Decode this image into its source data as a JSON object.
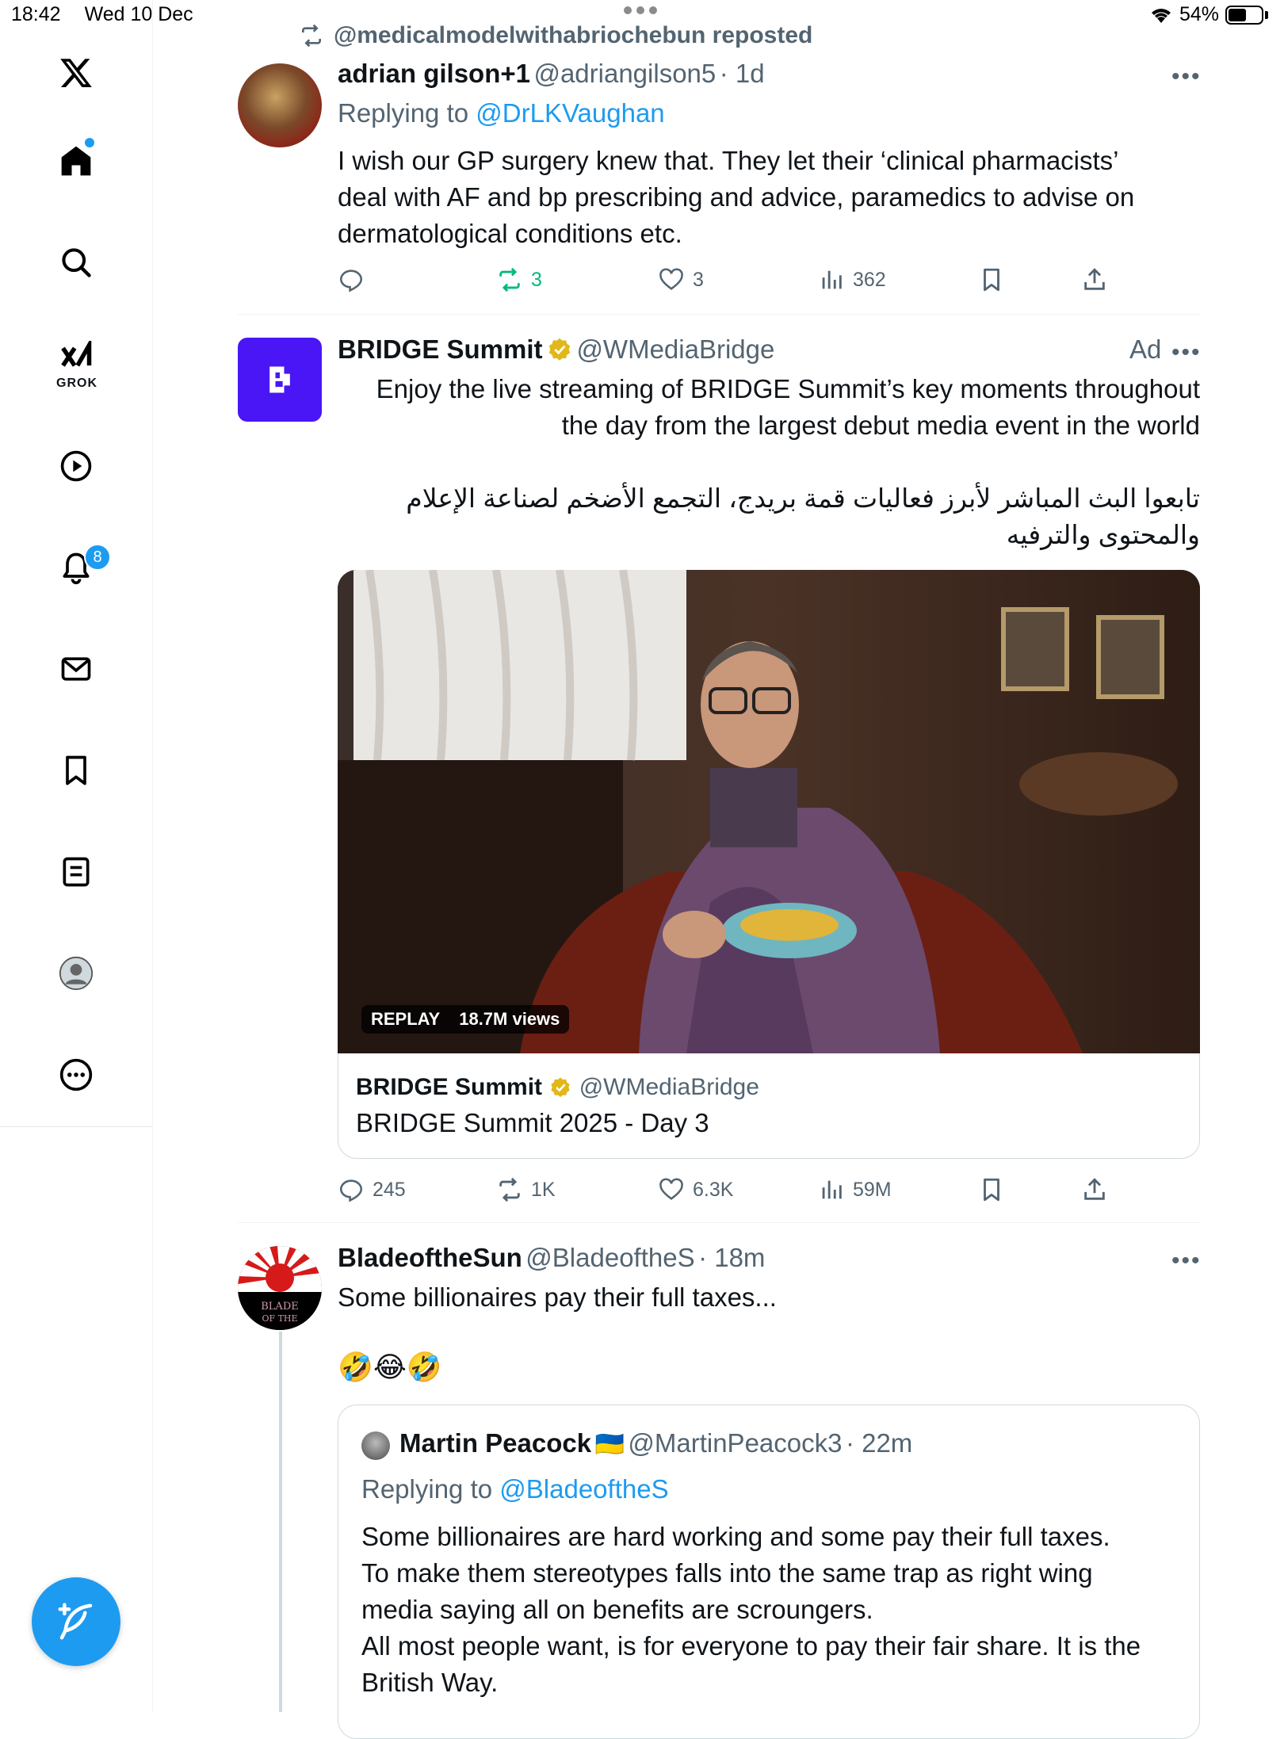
{
  "status_bar": {
    "time": "18:42",
    "date": "Wed 10 Dec",
    "battery": "54%",
    "battery_level": 0.54
  },
  "sidebar": {
    "items": [
      {
        "name": "x-logo-icon"
      },
      {
        "name": "home-icon"
      },
      {
        "name": "search-icon"
      },
      {
        "name": "grok-icon",
        "label": "GROK"
      },
      {
        "name": "video-icon"
      },
      {
        "name": "notifications-icon",
        "badge": "8"
      },
      {
        "name": "messages-icon"
      },
      {
        "name": "bookmarks-icon"
      },
      {
        "name": "lists-icon"
      },
      {
        "name": "profile-icon"
      },
      {
        "name": "more-icon"
      }
    ]
  },
  "posts": [
    {
      "repost_by": "@medicalmodelwithabriochebun reposted",
      "name": "adrian gilson+1",
      "handle": "@adriangilson5",
      "time": "· 1d",
      "replying_label": "Replying to",
      "replying_to": "@DrLKVaughan",
      "lines": [
        "I wish our GP surgery knew that. They let their ‘clinical pharmacists’",
        "deal with AF and bp prescribing and advice, paramedics to advise on",
        "dermatological conditions etc."
      ],
      "stats": {
        "replies": "",
        "reposts": "3",
        "likes": "3",
        "views": "362"
      }
    },
    {
      "name": "BRIDGE Summit",
      "handle": "@WMediaBridge",
      "ad_label": "Ad",
      "lines": [
        "Enjoy the live streaming of BRIDGE Summit’s key moments throughout",
        "the day from the largest debut media event in the world"
      ],
      "arabic_lines": [
        "تابعوا البث المباشر لأبرز فعاليات قمة بريدج، التجمع الأضخم لصناعة الإعلام",
        "والمحتوى والترفيه"
      ],
      "media": {
        "replay": "REPLAY",
        "views": "18.7M views"
      },
      "card": {
        "name": "BRIDGE Summit",
        "handle": "@WMediaBridge",
        "title": "BRIDGE Summit 2025 - Day 3"
      },
      "stats": {
        "replies": "245",
        "reposts": "1K",
        "likes": "6.3K",
        "views": "59M"
      }
    },
    {
      "name": "BladeoftheSun",
      "handle": "@BladeoftheS",
      "time": "· 18m",
      "text": "Some billionaires pay their full taxes...",
      "emoji": "🤣😂🤣",
      "avatar_text": [
        "BLADE",
        "OF THE"
      ],
      "quote": {
        "name": "Martin Peacock",
        "flag": "🇺🇦",
        "handle": "@MartinPeacock3",
        "time": "· 22m",
        "replying_label": "Replying to",
        "replying_to": "@BladeoftheS",
        "lines": [
          "Some billionaires are hard working and some pay their full taxes.",
          "To make them stereotypes falls into the same trap as right wing",
          "media saying all on benefits are scroungers.",
          "All most people want, is for everyone to pay their fair share. It is the",
          "British Way."
        ]
      }
    }
  ],
  "colors": {
    "accent": "#1d9bf0",
    "repost_green": "#00ba7c",
    "muted": "#536471",
    "bridge_purple": "#4a16f5"
  }
}
